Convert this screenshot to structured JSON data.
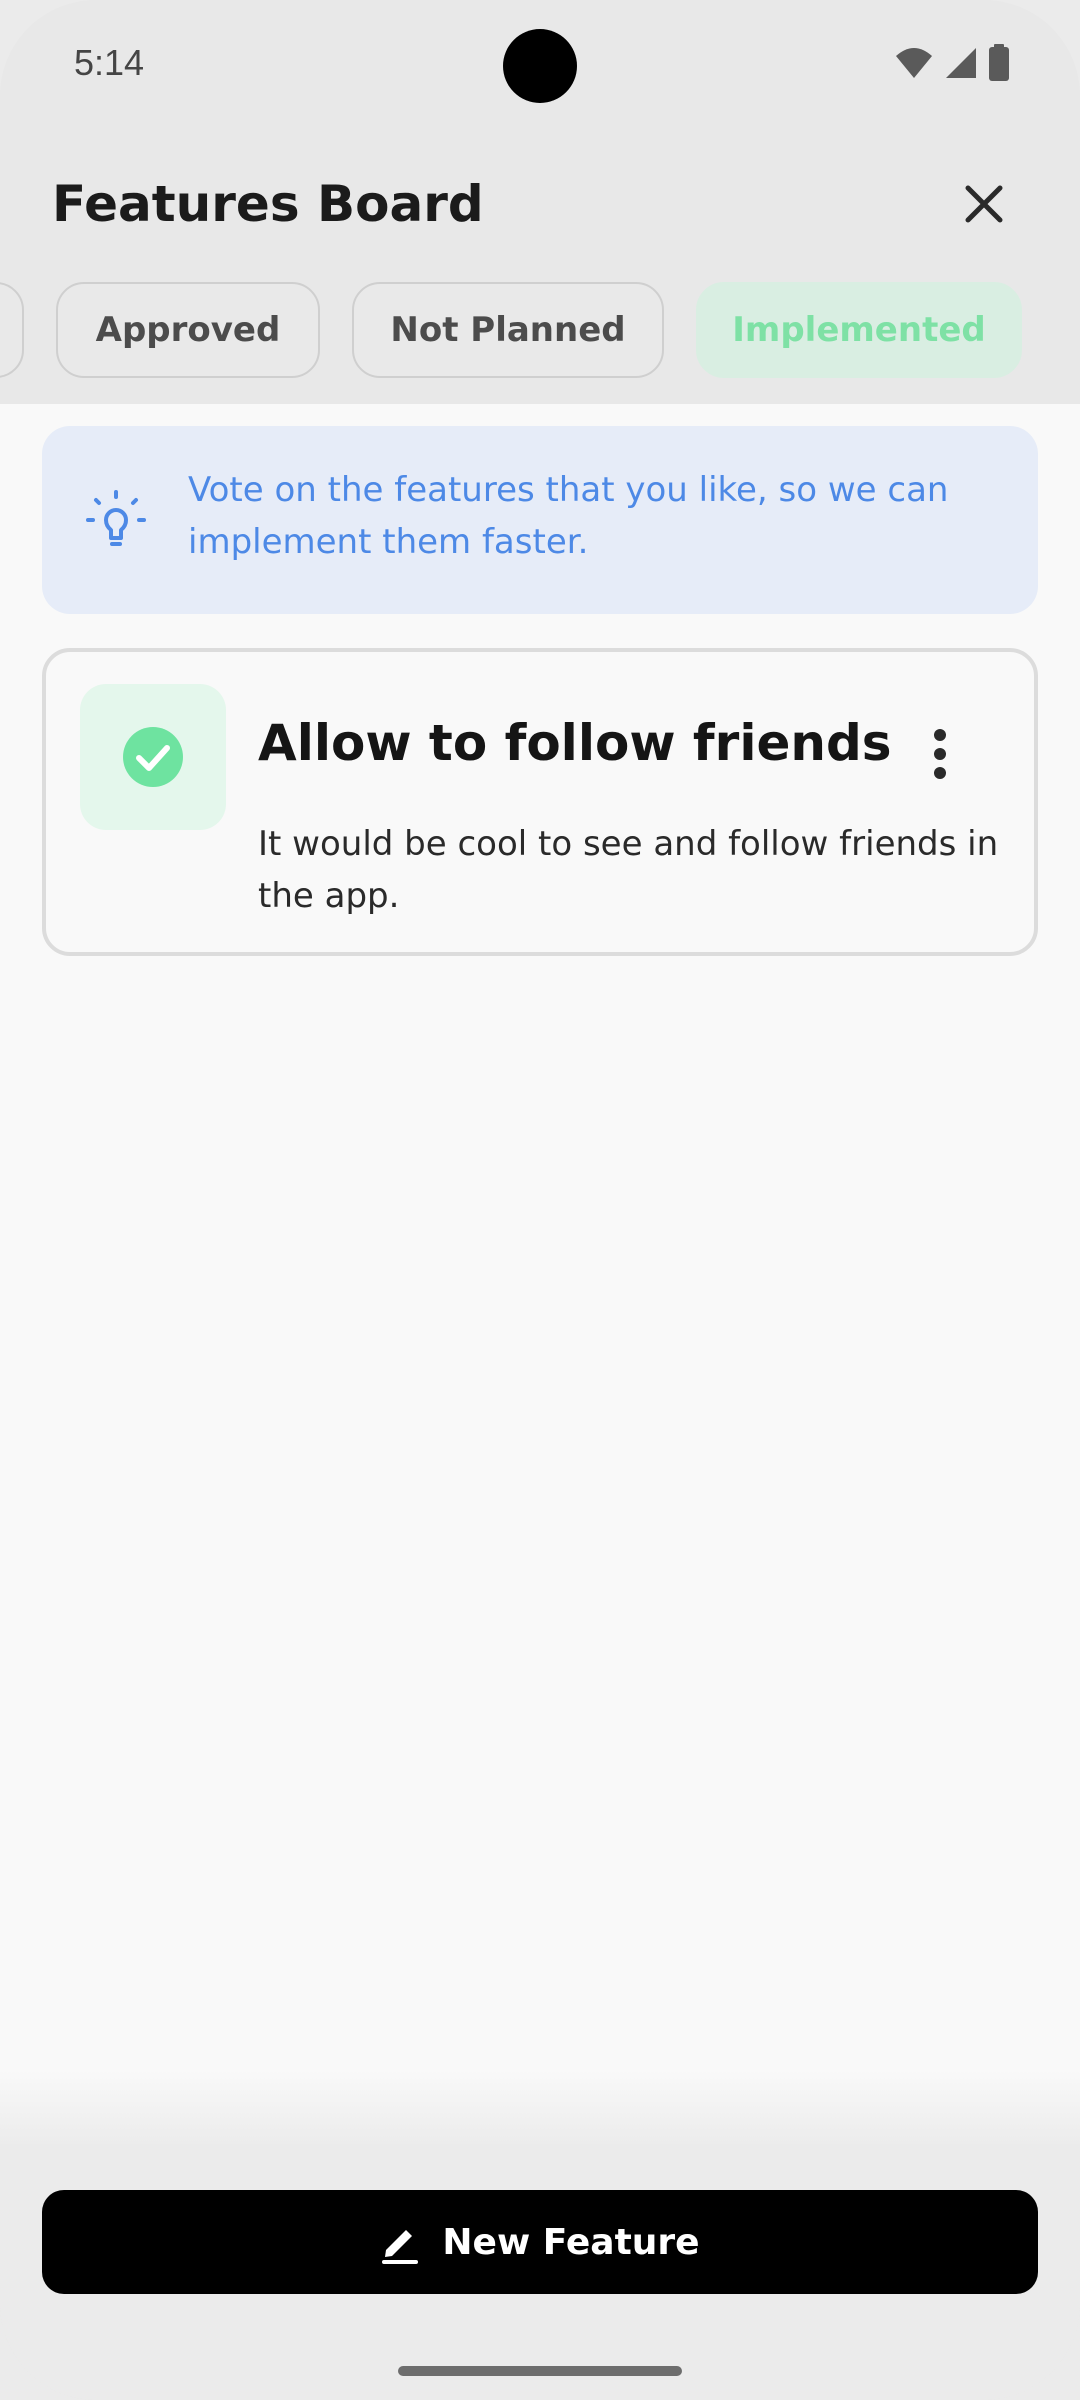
{
  "status_bar": {
    "time": "5:14"
  },
  "header": {
    "title": "Features Board",
    "close_icon": "close-icon"
  },
  "tabs": [
    {
      "label": "",
      "state": "partial"
    },
    {
      "label": "Approved",
      "state": "default"
    },
    {
      "label": "Not Planned",
      "state": "default"
    },
    {
      "label": "Implemented",
      "state": "selected"
    }
  ],
  "info_banner": {
    "icon": "lightbulb-icon",
    "text": "Vote on the features that you like, so we can implement them faster."
  },
  "features": [
    {
      "title": "Allow to follow friends",
      "description": "It would be cool to see and follow friends in the app.",
      "status_icon": "check-circle-icon",
      "menu_icon": "more-vertical-icon"
    }
  ],
  "bottom": {
    "new_feature_label": "New Feature",
    "new_feature_icon": "pencil-icon"
  },
  "colors": {
    "accent_green": "#7ee1a5",
    "accent_blue": "#4d89e6",
    "button_bg": "#000000"
  }
}
